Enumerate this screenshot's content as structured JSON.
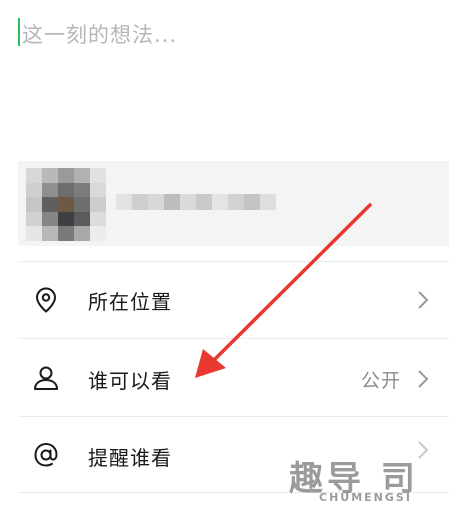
{
  "compose": {
    "placeholder": "这一刻的想法..."
  },
  "preview": {
    "thumb_colors": [
      "#d7d7d7",
      "#b9b9b9",
      "#9a9a9a",
      "#b1b1b1",
      "#e1e1e1",
      "#cfcfcf",
      "#8f8f8f",
      "#6d6d6d",
      "#7c7c7c",
      "#d9d9d9",
      "#c6c6c6",
      "#5f5f5f",
      "#6d5a45",
      "#6f6f6f",
      "#cdcdcd",
      "#d1d1d1",
      "#858585",
      "#3f3f44",
      "#5b5b5b",
      "#dcdcdc",
      "#e6e6e6",
      "#b8b8b8",
      "#7a7a7a",
      "#a8a8a8",
      "#ececec"
    ],
    "strip_colors": [
      "#e2e2e2",
      "#cfcfcf",
      "#d8d8d8",
      "#bdbdbd",
      "#dadada",
      "#c9c9c9",
      "#e4e4e4",
      "#d2d2d2",
      "#c4c4c4",
      "#dedede"
    ]
  },
  "options": [
    {
      "label": "所在位置",
      "value": "",
      "icon": "location-pin-icon"
    },
    {
      "label": "谁可以看",
      "value": "公开",
      "icon": "user-icon"
    },
    {
      "label": "提醒谁看",
      "value": "",
      "icon": "at-icon"
    }
  ],
  "colors": {
    "accent": "#2fbf5a",
    "arrow": "#e8382f"
  },
  "watermark": {
    "main": "趣导 司",
    "sub": "CHUMENGSI"
  }
}
